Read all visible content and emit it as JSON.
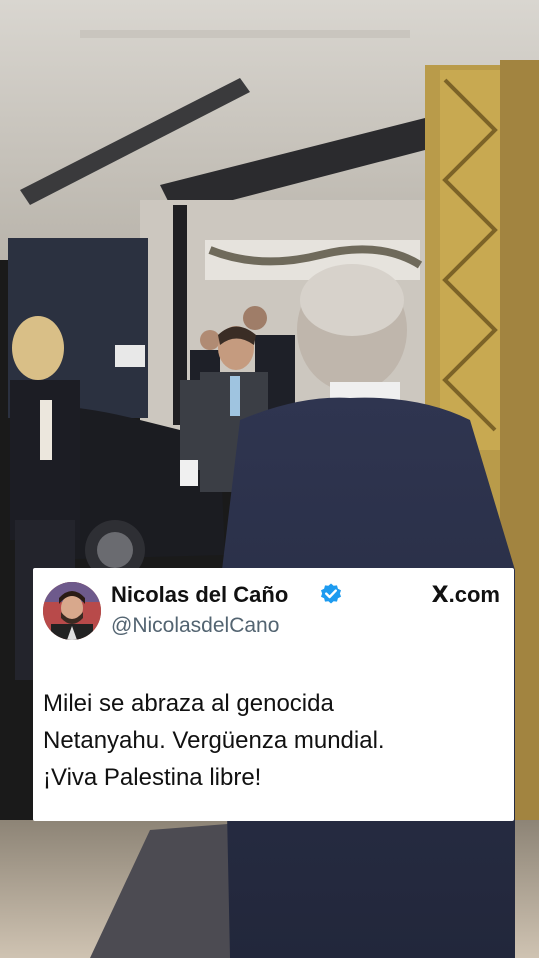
{
  "tweet": {
    "author_name": "Nicolas del Caño",
    "handle": "@NicolasdelCano",
    "source": ".com",
    "source_mark": "X",
    "text_lines": [
      "Milei se abraza al genocida",
      "Netanyahu. Vergüenza mundial.",
      "¡Viva Palestina libre!"
    ],
    "verified_color": "#1d9bf0"
  },
  "photo": {
    "icon": "video-frame-background"
  }
}
